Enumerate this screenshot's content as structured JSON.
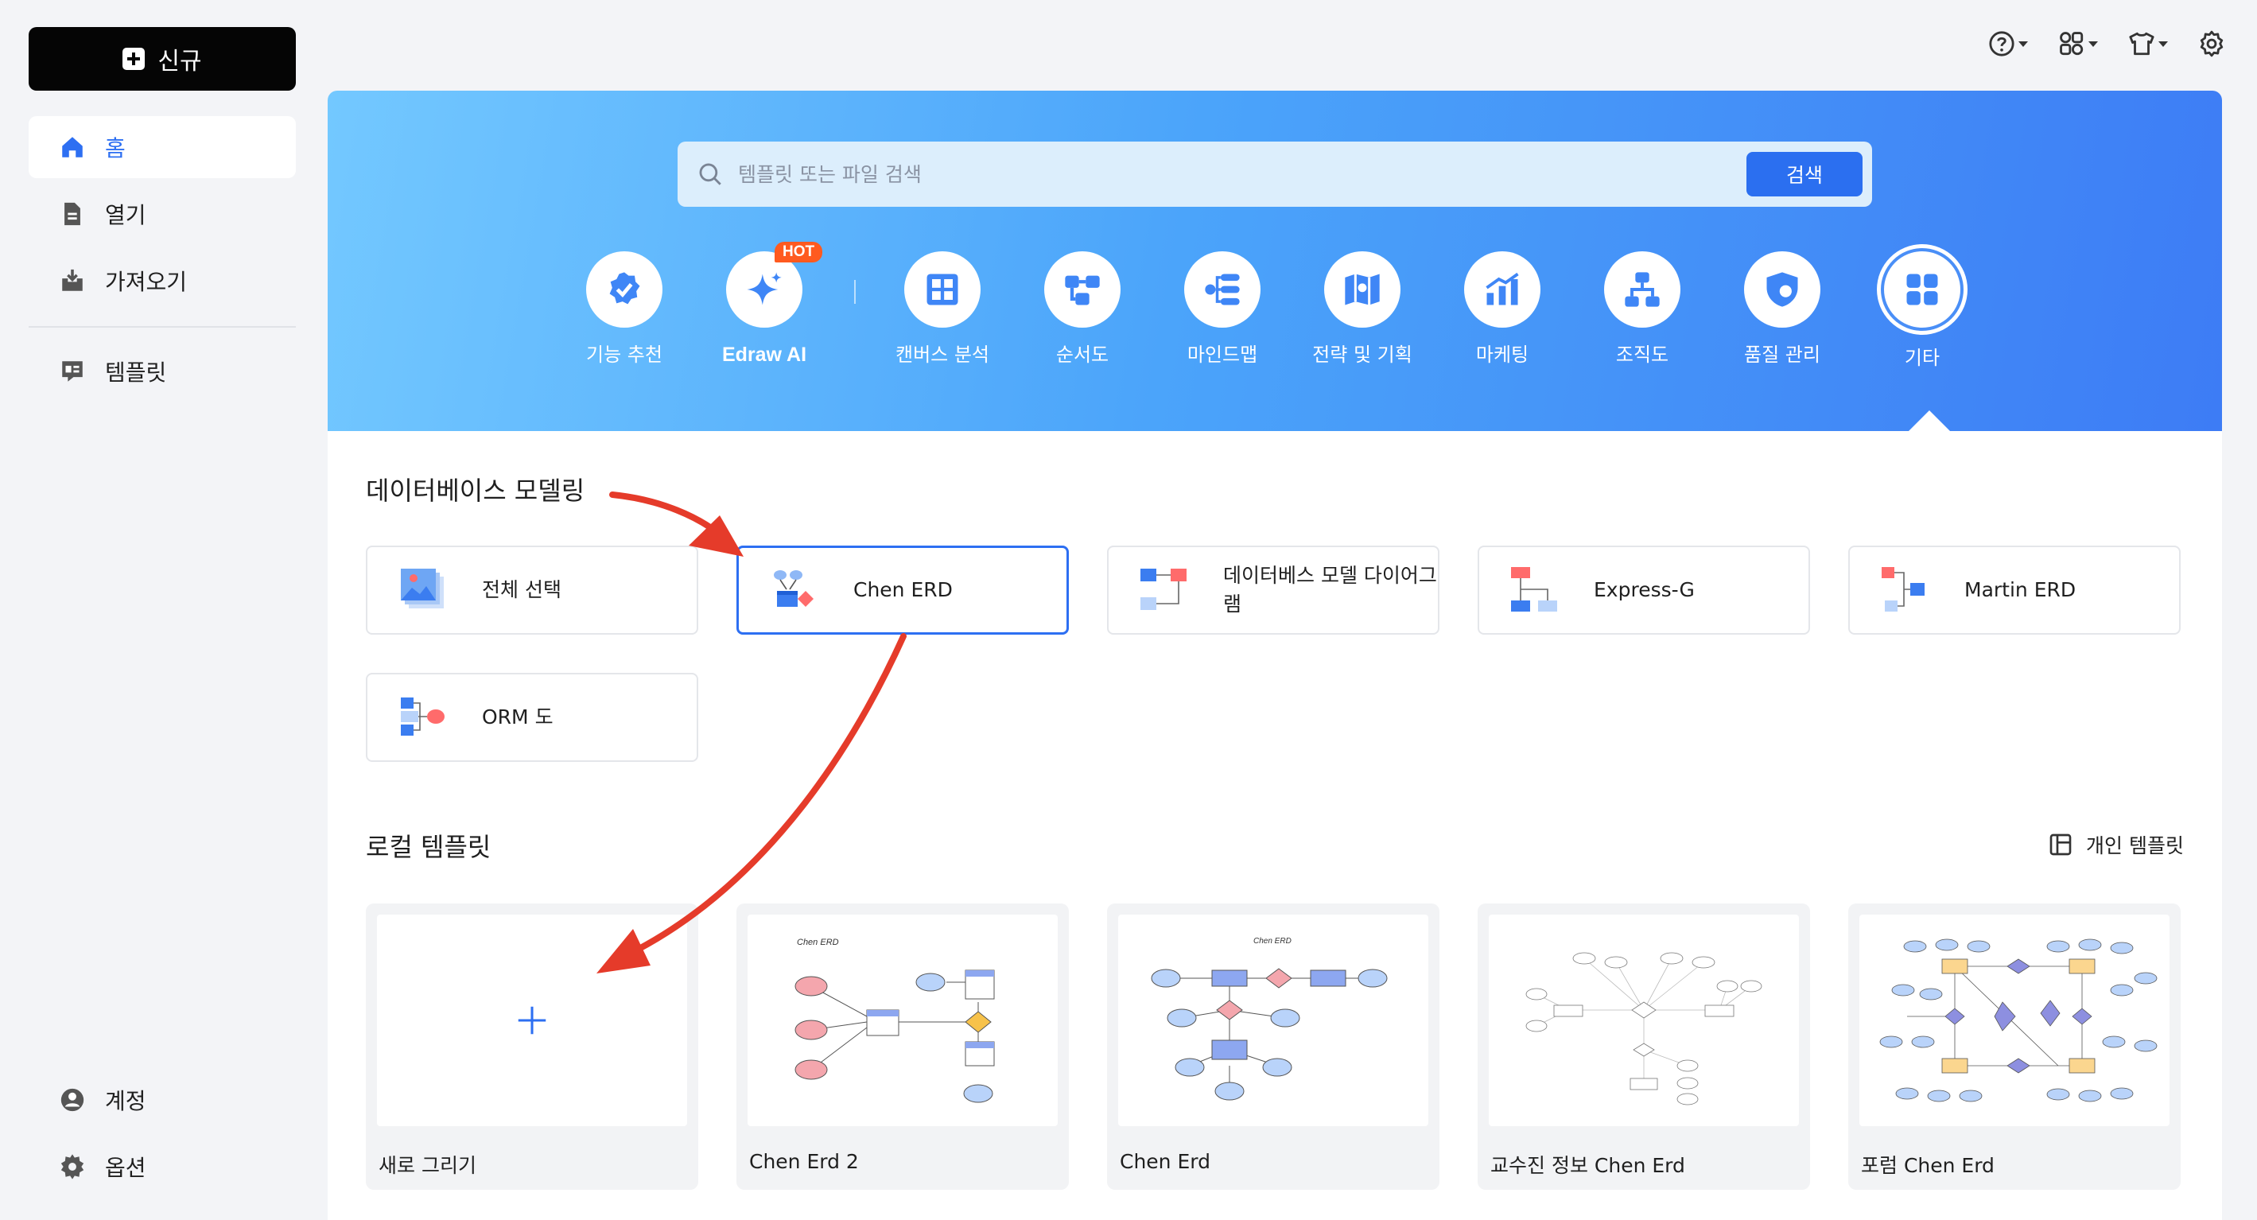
{
  "sidebar": {
    "new_label": "신규",
    "items": [
      {
        "label": "홈",
        "icon": "home-icon",
        "active": true
      },
      {
        "label": "열기",
        "icon": "file-icon"
      },
      {
        "label": "가져오기",
        "icon": "import-icon"
      },
      {
        "label": "템플릿",
        "icon": "template-icon"
      }
    ],
    "bottom_items": [
      {
        "label": "계정",
        "icon": "account-icon"
      },
      {
        "label": "옵션",
        "icon": "gear-icon"
      }
    ]
  },
  "topbar": {
    "icons": [
      "help-icon",
      "apps-icon",
      "shirt-icon",
      "settings-icon"
    ]
  },
  "search": {
    "placeholder": "템플릿 또는 파일 검색",
    "button_label": "검색"
  },
  "categories": [
    {
      "label": "기능 추천",
      "icon": "badge-check-icon"
    },
    {
      "label": "Edraw AI",
      "icon": "sparkle-icon",
      "badge": "HOT"
    },
    {
      "label": "캔버스 분석",
      "icon": "canvas-grid-icon"
    },
    {
      "label": "순서도",
      "icon": "flowchart-icon"
    },
    {
      "label": "마인드맵",
      "icon": "mindmap-icon"
    },
    {
      "label": "전략 및 기획",
      "icon": "map-icon"
    },
    {
      "label": "마케팅",
      "icon": "bar-chart-icon"
    },
    {
      "label": "조직도",
      "icon": "org-chart-icon"
    },
    {
      "label": "품질 관리",
      "icon": "shield-icon"
    },
    {
      "label": "기타",
      "icon": "grid-icon",
      "selected": true
    }
  ],
  "db_section": {
    "title": "데이터베이스 모델링",
    "options": [
      {
        "label": "전체 선택"
      },
      {
        "label": "Chen ERD",
        "selected": true
      },
      {
        "label": "데이터베스 모델 다이어그램"
      },
      {
        "label": "Express-G"
      },
      {
        "label": "Martin ERD"
      },
      {
        "label": "ORM 도"
      }
    ]
  },
  "local_section": {
    "title": "로컬 템플릿",
    "personal_link": "개인 템플릿",
    "new_drawing": "새로 그리기",
    "templates": [
      {
        "caption": "Chen Erd 2",
        "preview_title": "Chen ERD"
      },
      {
        "caption": "Chen Erd",
        "preview_title": "Chen ERD"
      },
      {
        "caption": "교수진 정보 Chen Erd"
      },
      {
        "caption": "포럼 Chen Erd"
      }
    ]
  },
  "colors": {
    "accent": "#2d6ff2",
    "annotation_arrow": "#e53b2a",
    "hot_badge": "#ff5a1f"
  }
}
